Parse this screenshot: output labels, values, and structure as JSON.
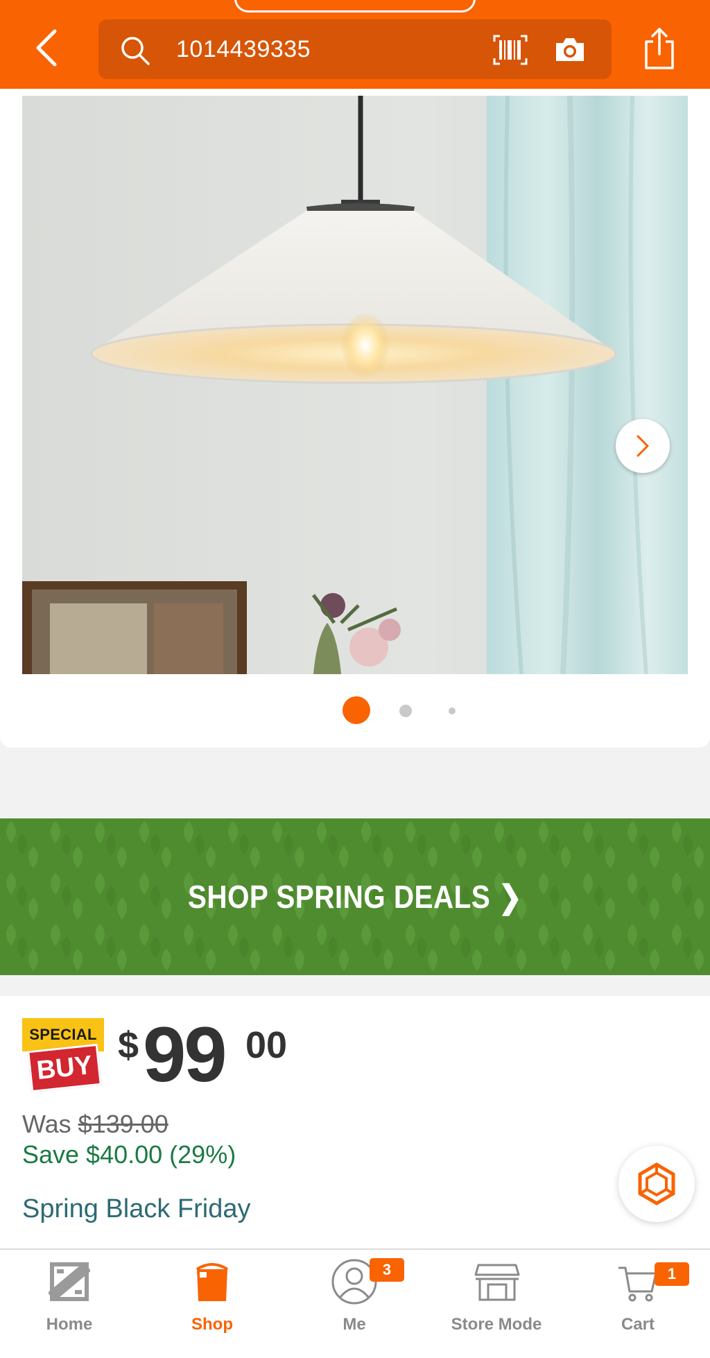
{
  "header": {
    "search_value": "1014439335"
  },
  "carousel": {
    "total_images": 3,
    "active_index": 0
  },
  "promo": {
    "label": "SHOP SPRING DEALS ❯"
  },
  "pricing": {
    "badge_top": "SPECIAL",
    "badge_bottom": "BUY",
    "currency": "$",
    "price_dollars": "99",
    "price_cents": "00",
    "was_label": "Was ",
    "was_price": "$139.00",
    "save_text": "Save $40.00 (29%)",
    "event_name": "Spring Black Friday"
  },
  "bottom_nav": {
    "items": [
      {
        "label": "Home",
        "icon": "home-depot-logo-icon",
        "active": false
      },
      {
        "label": "Shop",
        "icon": "bucket-icon",
        "active": true
      },
      {
        "label": "Me",
        "icon": "user-icon",
        "active": false,
        "badge": "3"
      },
      {
        "label": "Store Mode",
        "icon": "store-icon",
        "active": false
      },
      {
        "label": "Cart",
        "icon": "cart-icon",
        "active": false,
        "badge": "1"
      }
    ]
  },
  "colors": {
    "brand_orange": "#f96302",
    "search_bg": "#d75507",
    "promo_green": "#4f8c2f",
    "save_green": "#1b7a43",
    "event_teal": "#2d6a73"
  }
}
